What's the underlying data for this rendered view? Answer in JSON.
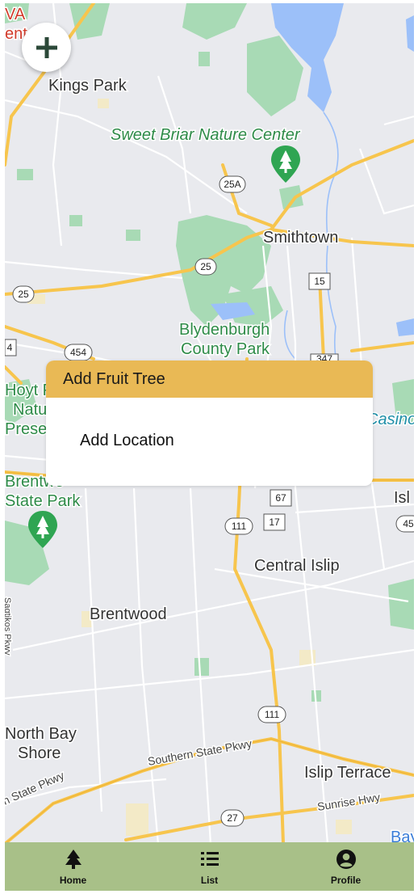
{
  "map": {
    "labels": {
      "kings_park": "Kings Park",
      "sweet_briar": "Sweet Briar Nature Center",
      "smithtown": "Smithtown",
      "blydenburgh_1": "Blydenburgh",
      "blydenburgh_2": "County Park",
      "hoyt_1": "Hoyt P",
      "hoyt_2": "Natu",
      "hoyt_3": "Prese",
      "casino": "Casino",
      "brentwood_sp_1": "Brentwo",
      "brentwood_sp_2": "State Park",
      "isl": "Isl",
      "central_islip": "Central Islip",
      "brentwood": "Brentwood",
      "north_bay_1": "North Bay",
      "north_bay_2": "Shore",
      "southern_state": "Southern State Pkwy",
      "islip_terrace": "Islip Terrace",
      "sunrise_hwy": "Sunrise Hwy",
      "state_pkwy": "n State Pkwy",
      "sagtikos": "Sagtikos Pkwy",
      "bay": "Bay",
      "va": "VA",
      "ent": "ent"
    },
    "shields": {
      "r25a": "25A",
      "r25_a": "25",
      "r25_b": "25",
      "r15": "15",
      "r454": "454",
      "r4": "4",
      "r347": "347",
      "r67": "67",
      "r17": "17",
      "r111_a": "111",
      "r111_b": "111",
      "r27": "27",
      "r45": "45"
    }
  },
  "fab": {
    "icon": "plus-icon"
  },
  "card": {
    "title": "Add Fruit Tree",
    "item": "Add Location"
  },
  "nav": {
    "items": [
      {
        "label": "Home",
        "icon": "tree-icon"
      },
      {
        "label": "List",
        "icon": "list-icon"
      },
      {
        "label": "Profile",
        "icon": "account-circle-icon"
      }
    ]
  },
  "colors": {
    "header": "#e9b955",
    "nav": "#a8c088",
    "park": "#a8dab5",
    "water": "#9cc0f9",
    "highway": "#f7c54d",
    "park_label": "#2e8b48"
  }
}
